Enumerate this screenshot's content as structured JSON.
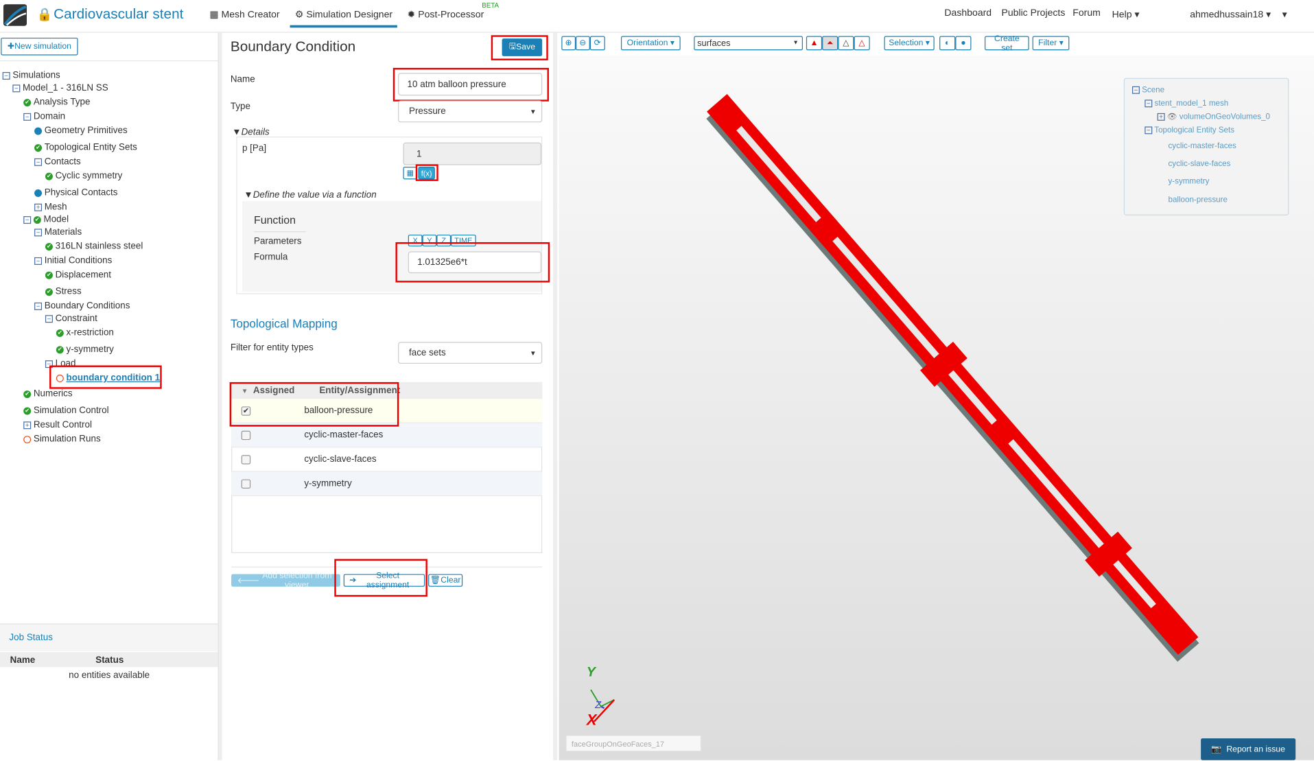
{
  "header": {
    "app_title": "Cardiovascular stent",
    "tabs": [
      {
        "label": "Mesh Creator"
      },
      {
        "label": "Simulation Designer"
      },
      {
        "label": "Post-Processor"
      }
    ],
    "beta": "BETA",
    "links": [
      "Dashboard",
      "Public Projects",
      "Forum",
      "Help"
    ],
    "user": "ahmedhussain18"
  },
  "sidebar": {
    "new_simulation": "New simulation",
    "tree": [
      "Simulations",
      "Model_1 - 316LN SS",
      "Analysis Type",
      "Domain",
      "Geometry Primitives",
      "Topological Entity Sets",
      "Contacts",
      "Cyclic symmetry",
      "Physical Contacts",
      "Mesh",
      "Model",
      "Materials",
      "316LN stainless steel",
      "Initial Conditions",
      "Displacement",
      "Stress",
      "Boundary Conditions",
      "Constraint",
      "x-restriction",
      "y-symmetry",
      "Load",
      "boundary condition 1",
      "Numerics",
      "Simulation Control",
      "Result Control",
      "Simulation Runs"
    ],
    "job_status": {
      "title": "Job Status",
      "col_name": "Name",
      "col_status": "Status",
      "empty": "no entities available"
    }
  },
  "form": {
    "title": "Boundary Condition",
    "save": "Save",
    "name_label": "Name",
    "name_value": "10 atm balloon pressure",
    "type_label": "Type",
    "type_value": "Pressure",
    "details": "Details",
    "p_label": "p [Pa]",
    "p_value": "1",
    "fx": "f(x)",
    "define_fn": "Define the value via a function",
    "function_title": "Function",
    "parameters_label": "Parameters",
    "params": [
      "X",
      "Y",
      "Z",
      "TIME"
    ],
    "formula_label": "Formula",
    "formula_value": "1.01325e6*t",
    "topo_title": "Topological Mapping",
    "filter_label": "Filter for entity types",
    "filter_value": "face sets",
    "col_assigned": "Assigned",
    "col_entity": "Entity/Assignment",
    "rows": [
      {
        "name": "balloon-pressure",
        "checked": true
      },
      {
        "name": "cyclic-master-faces",
        "checked": false
      },
      {
        "name": "cyclic-slave-faces",
        "checked": false
      },
      {
        "name": "y-symmetry",
        "checked": false
      }
    ],
    "add_selection": "Add selection from viewer",
    "select_assignment": "Select assignment",
    "clear": "Clear"
  },
  "viewer": {
    "orientation": "Orientation",
    "render_mode": "surfaces",
    "selection": "Selection",
    "create_set": "Create set",
    "filter": "Filter",
    "scene": [
      "Scene",
      "stent_model_1 mesh",
      "volumeOnGeoVolumes_0",
      "Topological Entity Sets",
      "cyclic-master-faces",
      "cyclic-slave-faces",
      "y-symmetry",
      "balloon-pressure"
    ],
    "status_field": "faceGroupOnGeoFaces_17",
    "axes": {
      "x": "X",
      "y": "Y",
      "z": "Z"
    },
    "report": "Report an issue",
    "stent_color": "#ee0000"
  }
}
